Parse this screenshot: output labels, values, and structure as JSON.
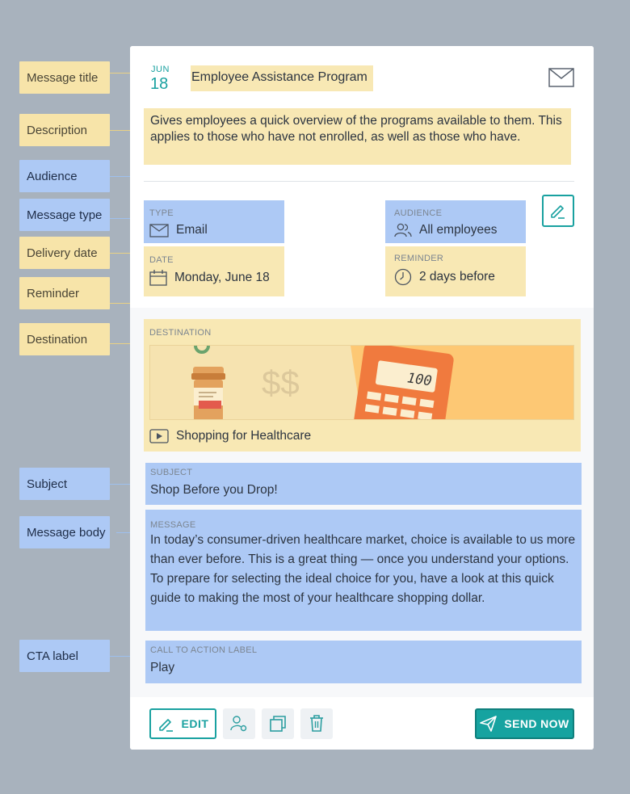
{
  "annotations": {
    "message_title": "Message title",
    "description": "Description",
    "audience": "Audience",
    "message_type": "Message type",
    "delivery_date": "Delivery date",
    "reminder": "Reminder",
    "destination": "Destination",
    "subject": "Subject",
    "message_body": "Message body",
    "cta_label": "CTA label"
  },
  "header": {
    "month": "JUN",
    "day": "18",
    "title": "Employee Assistance Program",
    "mail_icon": "envelope-icon"
  },
  "description": "Gives employees a quick overview of the programs available to them. This applies to those who have not enrolled, as well as those who have.",
  "fields": {
    "type_label": "TYPE",
    "type_value": "Email",
    "audience_label": "AUDIENCE",
    "audience_value": "All employees",
    "date_label": "DATE",
    "date_value": "Monday, June 18",
    "reminder_label": "REMINDER",
    "reminder_value": "2 days before"
  },
  "destination": {
    "label": "DESTINATION",
    "banner_calculator_display": "100",
    "banner_dollar_text": "$$",
    "link_text": "Shopping for Healthcare"
  },
  "subject": {
    "label": "SUBJECT",
    "value": "Shop Before you Drop!"
  },
  "message": {
    "label": "MESSAGE",
    "value": "In today’s consumer-driven healthcare market, choice is available to us more than ever before. This is a great thing — once you understand your options. To prepare for selecting the ideal choice for you, have a look at this quick guide to making the most of your healthcare shopping dollar."
  },
  "cta": {
    "label": "CALL TO ACTION LABEL",
    "value": "Play"
  },
  "footer": {
    "edit_label": "EDIT",
    "send_label": "SEND NOW"
  },
  "colors": {
    "accent": "#19a1a0",
    "annotation_yellow": "#f7e4a9",
    "annotation_blue": "#adc9f5",
    "background": "#a8b2bd"
  }
}
